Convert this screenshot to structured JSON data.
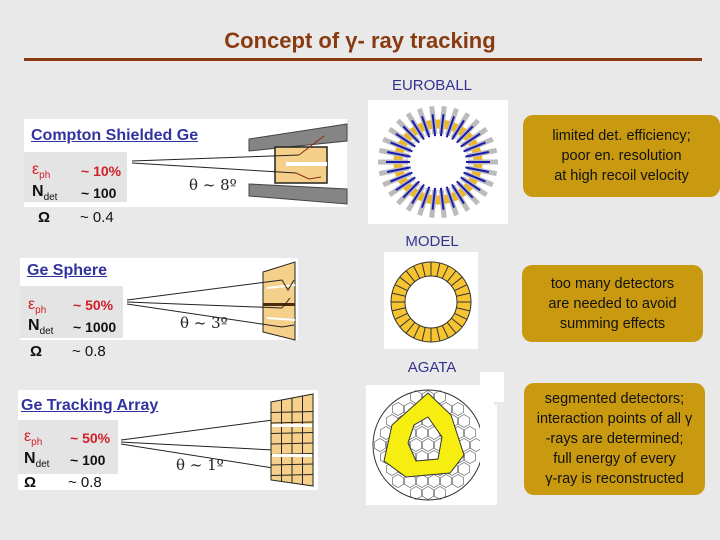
{
  "title": "Concept of γ- ray tracking",
  "colors": {
    "title": "#8a3a10",
    "heading_blue": "#3333a0",
    "efficiency_red": "#d0202a",
    "callout_bg": "#c99a10",
    "detector_fill": "#f5d08a",
    "background": "#e9e9e9"
  },
  "concepts": [
    {
      "heading": "Compton Shielded Ge",
      "eff_symbol": "ε",
      "eff_sub": "ph",
      "eff_value": "~ 10%",
      "ndet_symbol": "N",
      "ndet_sub": "det",
      "ndet_value": "~ 100",
      "omega_symbol": "Ω",
      "omega_value": "~ 0.4",
      "theta": "θ ~ 8º",
      "array_label": "EUROBALL",
      "callout": [
        "limited det. efficiency;",
        "poor en. resolution",
        "at high recoil velocity"
      ]
    },
    {
      "heading": "Ge Sphere",
      "eff_symbol": "ε",
      "eff_sub": "ph",
      "eff_value": "~ 50%",
      "ndet_symbol": "N",
      "ndet_sub": "det",
      "ndet_value": "~ 1000",
      "omega_symbol": "Ω",
      "omega_value": "~ 0.8",
      "theta": "θ ~ 3º",
      "array_label": "MODEL",
      "callout": [
        "too many detectors",
        "are needed to avoid",
        "summing effects"
      ]
    },
    {
      "heading": "Ge Tracking Array",
      "eff_symbol": "ε",
      "eff_sub": "ph",
      "eff_value": "~ 50%",
      "ndet_symbol": "N",
      "ndet_sub": "det",
      "ndet_value": "~ 100",
      "omega_symbol": "Ω",
      "omega_value": "~ 0.8",
      "theta": "θ ~ 1º",
      "array_label": "AGATA",
      "callout": [
        "segmented detectors;",
        "interaction points of all γ",
        "-rays are determined;",
        "full energy of every",
        "γ-ray is reconstructed"
      ]
    }
  ]
}
